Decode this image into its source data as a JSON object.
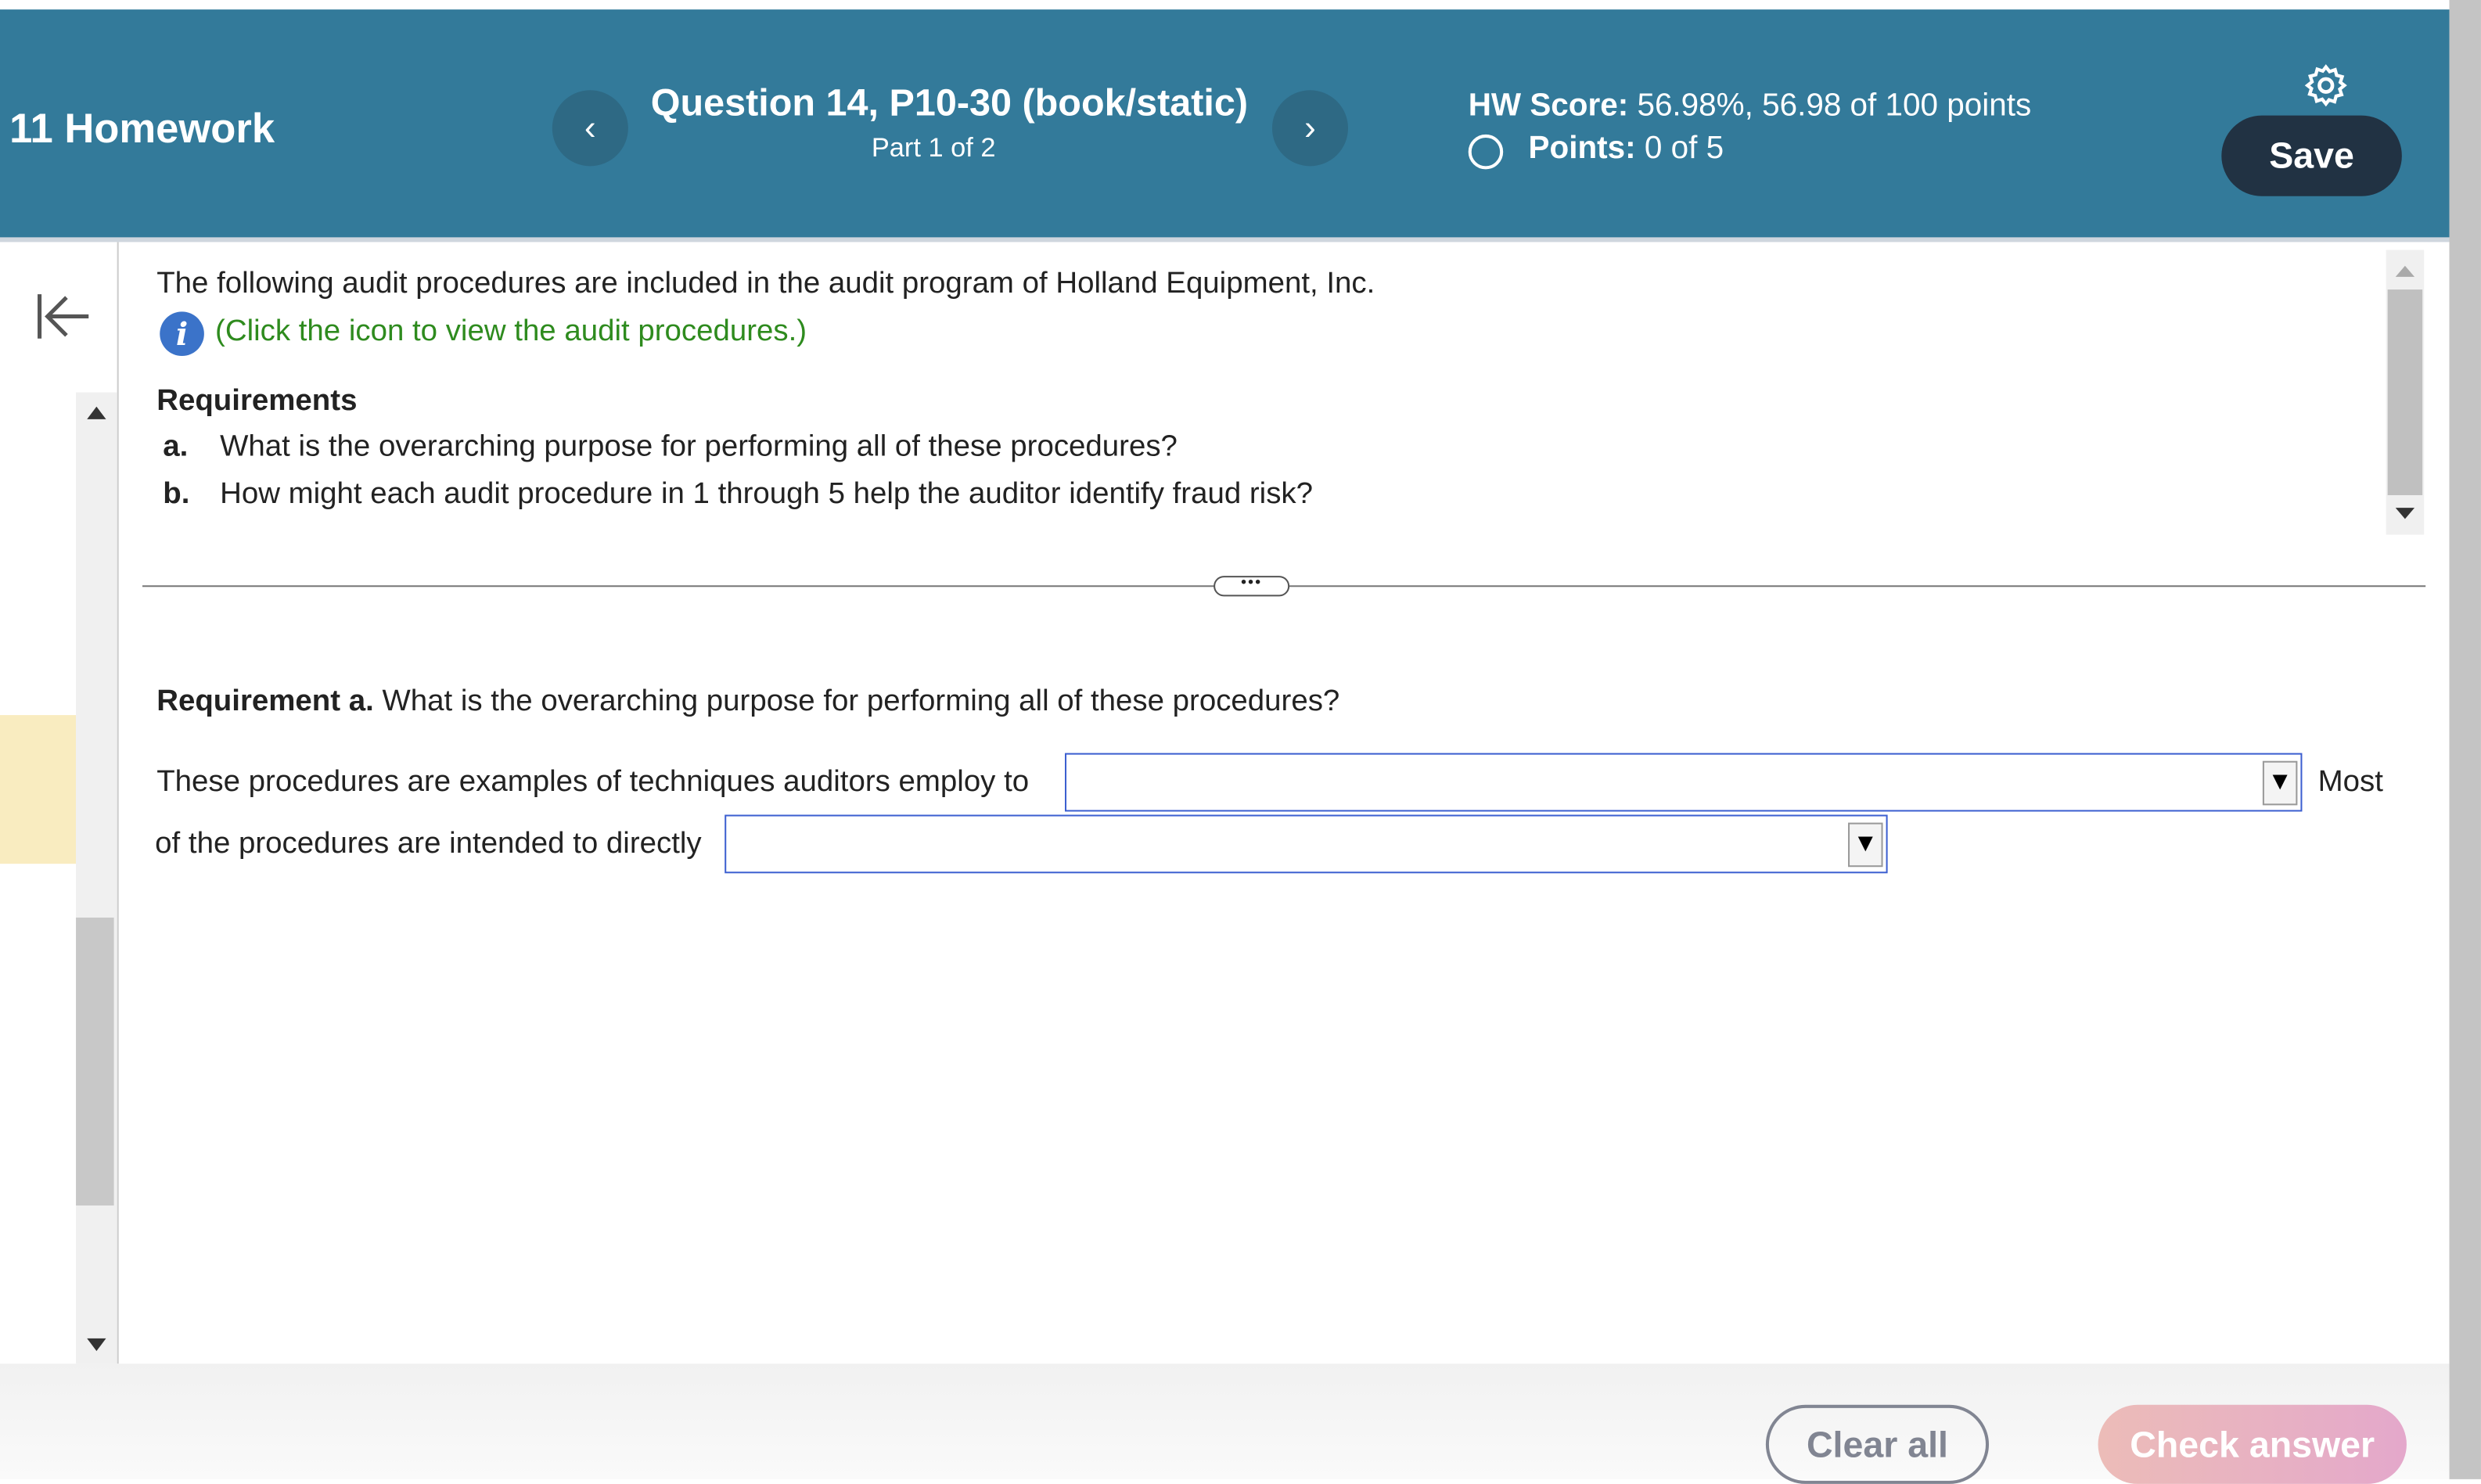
{
  "header": {
    "assignment": "11 Homework",
    "question_title": "Question 14, P10-30 (book/static)",
    "part": "Part 1 of 2",
    "hw_score_label": "HW Score:",
    "hw_score_value": "56.98%, 56.98 of 100 points",
    "points_label": "Points:",
    "points_value": "0 of 5",
    "save_label": "Save",
    "prev_icon": "‹",
    "next_icon": "›"
  },
  "content": {
    "intro": "The following audit procedures are included in the audit program of Holland Equipment, Inc.",
    "info_link": "(Click the icon to view the audit procedures.)",
    "requirements_heading": "Requirements",
    "requirements": [
      {
        "letter": "a.",
        "text": "What is the overarching purpose for performing all of these procedures?"
      },
      {
        "letter": "b.",
        "text": "How might each audit procedure in 1 through 5 help the auditor identify fraud risk?"
      }
    ],
    "req_a_label": "Requirement a.",
    "req_a_text": " What is the overarching purpose for performing all of these procedures?",
    "sentence1": "These procedures are examples of techniques auditors employ to",
    "dropdown1_value": "",
    "after_dropdown1": "Most",
    "sentence2": "of the procedures are intended to directly",
    "dropdown2_value": ""
  },
  "footer": {
    "clear_label": "Clear all",
    "check_label": "Check answer"
  },
  "colors": {
    "header": "#337a9a",
    "save": "#213243",
    "link": "#2e8b1e",
    "dropdown_border": "#3c5fd0"
  }
}
